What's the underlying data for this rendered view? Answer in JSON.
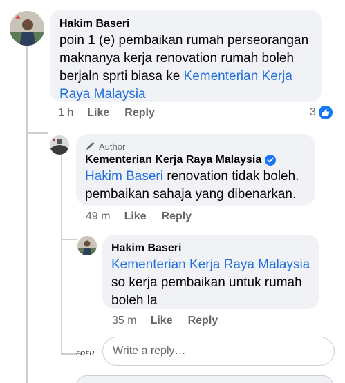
{
  "comments": [
    {
      "author": "Hakim Baseri",
      "text_lines": [
        "poin 1 (e) pembaikan rumah perseorangan",
        "maknanya kerja renovation rumah boleh",
        "berjaln sprti biasa ke "
      ],
      "mention_part1": "Kementerian Kerja",
      "mention_part2": "Raya Malaysia",
      "time": "1 h",
      "like_label": "Like",
      "reply_label": "Reply",
      "reaction_count": "3",
      "reaction_icon": "like-icon"
    },
    {
      "author_badge_label": "Author",
      "author": "Kementerian Kerja Raya Malaysia",
      "verified_icon": "verified-check-icon",
      "mention": "Hakim Baseri",
      "text_after_mention": " renovation tidak boleh.",
      "text_line2": "pembaikan sahaja yang dibenarkan.",
      "time": "49 m",
      "like_label": "Like",
      "reply_label": "Reply"
    },
    {
      "author": "Hakim Baseri",
      "mention": "Kementerian Kerja Raya Malaysia",
      "text_lines": [
        "so kerja pembaikan untuk rumah",
        "boleh la"
      ],
      "time": "35 m",
      "like_label": "Like",
      "reply_label": "Reply"
    }
  ],
  "reply_box": {
    "placeholder": "Write a reply…",
    "avatar_text": "FOFU"
  },
  "colors": {
    "link": "#216fdb",
    "bubble": "#f0f2f5",
    "meta": "#65676b",
    "like_blue": "#1877f2"
  }
}
